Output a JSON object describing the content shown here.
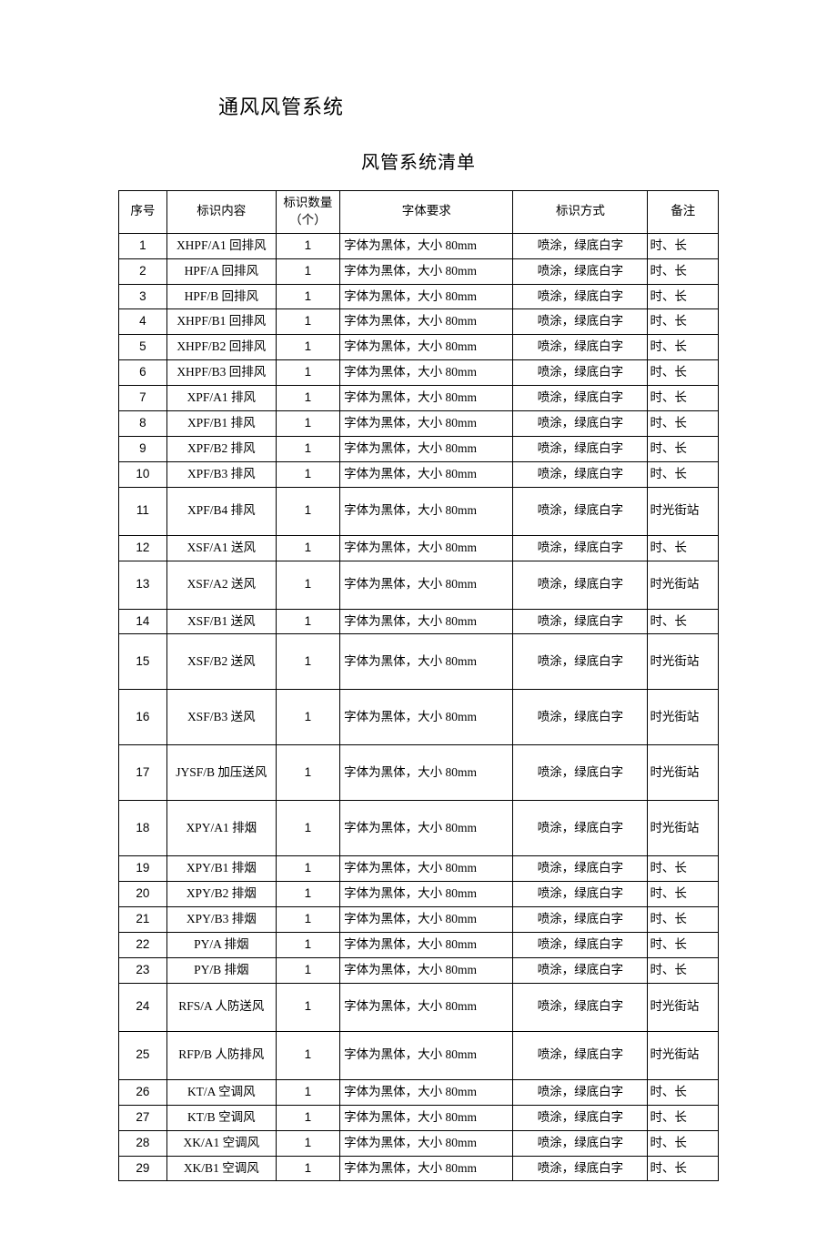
{
  "title": "通风风管系统",
  "subtitle": "风管系统清单",
  "headers": {
    "seq": "序号",
    "content": "标识内容",
    "qty": "标识数量（个）",
    "font": "字体要求",
    "method": "标识方式",
    "remark": "备注"
  },
  "font_req_text": "字体为黑体，大小 80mm",
  "method_text": "喷涂，绿底白字",
  "remark_short": "时、长",
  "remark_long": "时光街站",
  "rows": [
    {
      "seq": "1",
      "content": "XHPF/A1 回排风",
      "qty": "1",
      "remark": "short",
      "h": ""
    },
    {
      "seq": "2",
      "content": "HPF/A 回排风",
      "qty": "1",
      "remark": "short",
      "h": ""
    },
    {
      "seq": "3",
      "content": "HPF/B 回排风",
      "qty": "1",
      "remark": "short",
      "h": ""
    },
    {
      "seq": "4",
      "content": "XHPF/B1 回排风",
      "qty": "1",
      "remark": "short",
      "h": ""
    },
    {
      "seq": "5",
      "content": "XHPF/B2 回排风",
      "qty": "1",
      "remark": "short",
      "h": ""
    },
    {
      "seq": "6",
      "content": "XHPF/B3 回排风",
      "qty": "1",
      "remark": "short",
      "h": ""
    },
    {
      "seq": "7",
      "content": "XPF/A1 排风",
      "qty": "1",
      "remark": "short",
      "h": ""
    },
    {
      "seq": "8",
      "content": "XPF/B1 排风",
      "qty": "1",
      "remark": "short",
      "h": ""
    },
    {
      "seq": "9",
      "content": "XPF/B2 排风",
      "qty": "1",
      "remark": "short",
      "h": ""
    },
    {
      "seq": "10",
      "content": "XPF/B3 排风",
      "qty": "1",
      "remark": "short",
      "h": ""
    },
    {
      "seq": "11",
      "content": "XPF/B4 排风",
      "qty": "1",
      "remark": "long",
      "h": "tall"
    },
    {
      "seq": "12",
      "content": "XSF/A1 送风",
      "qty": "1",
      "remark": "short",
      "h": ""
    },
    {
      "seq": "13",
      "content": "XSF/A2 送风",
      "qty": "1",
      "remark": "long",
      "h": "tall"
    },
    {
      "seq": "14",
      "content": "XSF/B1 送风",
      "qty": "1",
      "remark": "short",
      "h": ""
    },
    {
      "seq": "15",
      "content": "XSF/B2 送风",
      "qty": "1",
      "remark": "long",
      "h": "tall-more"
    },
    {
      "seq": "16",
      "content": "XSF/B3 送风",
      "qty": "1",
      "remark": "long",
      "h": "tall-more"
    },
    {
      "seq": "17",
      "content": "JYSF/B 加压送风",
      "qty": "1",
      "remark": "long",
      "h": "tall-more"
    },
    {
      "seq": "18",
      "content": "XPY/A1 排烟",
      "qty": "1",
      "remark": "long",
      "h": "tall-more"
    },
    {
      "seq": "19",
      "content": "XPY/B1 排烟",
      "qty": "1",
      "remark": "short",
      "h": ""
    },
    {
      "seq": "20",
      "content": "XPY/B2 排烟",
      "qty": "1",
      "remark": "short",
      "h": ""
    },
    {
      "seq": "21",
      "content": "XPY/B3 排烟",
      "qty": "1",
      "remark": "short",
      "h": ""
    },
    {
      "seq": "22",
      "content": "PY/A 排烟",
      "qty": "1",
      "remark": "short",
      "h": ""
    },
    {
      "seq": "23",
      "content": "PY/B 排烟",
      "qty": "1",
      "remark": "short",
      "h": ""
    },
    {
      "seq": "24",
      "content": "RFS/A 人防送风",
      "qty": "1",
      "remark": "long",
      "h": "tall"
    },
    {
      "seq": "25",
      "content": "RFP/B 人防排风",
      "qty": "1",
      "remark": "long",
      "h": "tall"
    },
    {
      "seq": "26",
      "content": "KT/A 空调风",
      "qty": "1",
      "remark": "short",
      "h": ""
    },
    {
      "seq": "27",
      "content": "KT/B 空调风",
      "qty": "1",
      "remark": "short",
      "h": ""
    },
    {
      "seq": "28",
      "content": "XK/A1 空调风",
      "qty": "1",
      "remark": "short",
      "h": ""
    },
    {
      "seq": "29",
      "content": "XK/B1 空调风",
      "qty": "1",
      "remark": "short",
      "h": ""
    }
  ]
}
